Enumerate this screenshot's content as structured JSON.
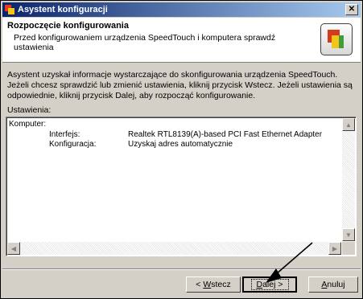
{
  "window": {
    "title": "Asystent konfiguracji",
    "close_glyph": "✕"
  },
  "header": {
    "title": "Rozpoczęcie konfigurowania",
    "subtitle": "Przed konfigurowaniem urządzenia SpeedTouch i komputera sprawdź ustawienia"
  },
  "body": {
    "info": "Asystent uzyskał informacje wystarczające do skonfigurowania urządzenia SpeedTouch. Jeżeli chcesz sprawdzić lub zmienić ustawienia, kliknij przycisk Wstecz. Jeżeli ustawienia są odpowiednie, kliknij przycisk Dalej, aby rozpocząć konfigurowanie.",
    "settings_label": "Ustawienia:"
  },
  "settings": {
    "group": "Komputer:",
    "rows": [
      {
        "key": "Interfejs:",
        "value": "Realtek RTL8139(A)-based PCI Fast Ethernet Adapter"
      },
      {
        "key": "Konfiguracja:",
        "value": "Uzyskaj adres automatycznie"
      }
    ]
  },
  "buttons": {
    "back": {
      "prefix": "< ",
      "mnemonic": "W",
      "rest": "stecz"
    },
    "next": {
      "mnemonic": "D",
      "rest": "alej >"
    },
    "cancel": {
      "mnemonic": "A",
      "rest": "nuluj"
    }
  },
  "colors": {
    "titlebar_start": "#0a246a",
    "titlebar_end": "#a6caf0",
    "dialog_face": "#d4d0c8"
  }
}
